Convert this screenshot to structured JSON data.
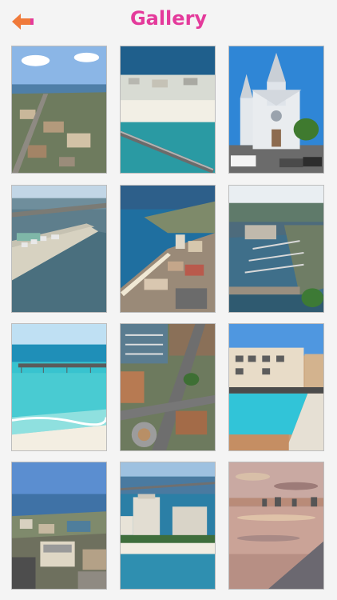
{
  "header": {
    "title": "Gallery",
    "back_icon": "back-arrow-icon",
    "accent_color": "#e43a9b",
    "back_color": "#f07a3a"
  },
  "gallery": {
    "photos": [
      {
        "subject": "aerial-city-coast"
      },
      {
        "subject": "beach-pier-aerial"
      },
      {
        "subject": "white-church"
      },
      {
        "subject": "bridge-island-aerial"
      },
      {
        "subject": "island-beach-aerial"
      },
      {
        "subject": "marina-harbor-aerial"
      },
      {
        "subject": "beach-fishing-pier"
      },
      {
        "subject": "marina-city-streets"
      },
      {
        "subject": "resort-pool"
      },
      {
        "subject": "aerial-downtown-bay"
      },
      {
        "subject": "beachfront-hotels"
      },
      {
        "subject": "sunset-water-reflection"
      }
    ]
  }
}
